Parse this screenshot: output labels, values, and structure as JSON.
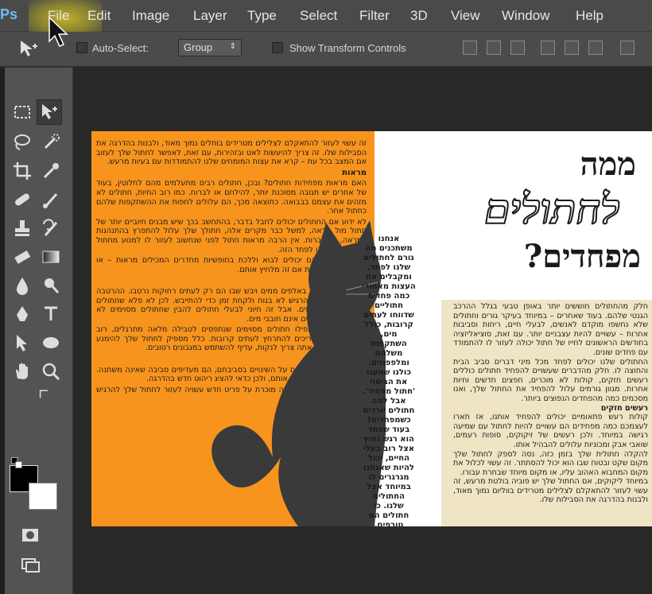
{
  "app": {
    "logo": "Ps",
    "menu": [
      "File",
      "Edit",
      "Image",
      "Layer",
      "Type",
      "Select",
      "Filter",
      "3D",
      "View",
      "Window",
      "Help"
    ]
  },
  "options": {
    "auto_select_label": "Auto-Select:",
    "group_value": "Group",
    "show_transform_label": "Show Transform Controls"
  },
  "colors": {
    "accent_orange": "#f7941d",
    "beige": "#efe4c4",
    "foreground": "#000000",
    "background": "#ffffff"
  },
  "doc": {
    "title_line1": "ממה",
    "title_line2": "לחתולים",
    "title_line3": "מפחדים?",
    "left_column": [
      {
        "type": "p",
        "text": "זה עשוי לעזור להתאקלם לצלילים מטרידים בוחלים נמוך מאוד, ולבנות בהדרגה את הסבילות שלו. זה צריך להיעשות לאט ובזהירות, עם זאת, לאפשר לחתול שלך לעזוב אם המצב בכל עת – קרא את עצות המומחים שלנו להתמודדות עם בעיות מרעש."
      },
      {
        "type": "h",
        "text": "מראות"
      },
      {
        "type": "p",
        "text": "האם מראות מפחידות חתולים? ובכן, חתולים רבים מתעלמים מהם לחלוטין, בעוד של אחרים יש תגובה מסוכנת יותר, להילחם או לברוח. כמו רוב החיות, חתולים לא מזהים את עצמם בבבואה. כתוצאה מכך, הם עלולים לחפות את ההשתקפות שלהם כחתול אחר."
      },
      {
        "type": "p",
        "text": "לא ידוע אם החתולים יכולים לחבל בדבר, בהתחשב בכך שיש מבנים חיוביים יותר של חתול מול מראה, למשל כבר מקרים אלה, חתולך שלך עלול להתפרץ בהתנהגות במראה, או לברוח. אין הרבה מראות חתול לפני שנחשוב לעזור לו למנוע מחתול להיות מפחיד או לפחד הזה."
      },
      {
        "type": "p",
        "text": "מלבד לוודא שהם יכולים לבוא וללכת בחופשיות מחדרים המכילים מראות – או להסיר את המראות אם זה מלחיץ אותם."
      },
      {
        "type": "h",
        "text": "מים"
      },
      {
        "type": "p",
        "text": "חתולים מתפחדים באלפים ממים ויבש שבו הם רק לעתים רחוקות נרטבו. ההרטבה גורמת לחתולים להרגיש לא בנוח ולקחת זמן כדי להתייבש. לכן לא פלא שחתולים רבים מפחדים ממים. אבל זה חיוני לבעלי חתולים להבין שחתולים מסוימים לא מחבבים מים ואחרים אינם חובבי מים."
      },
      {
        "type": "p",
        "text": "ושחייה. בעוד שאפילו חתולים מסוימים שנתפסים לטבילה מלאה מתרגלים, רוב החתולים אינם צריכים להתרחץ לעתים קרובות. כלל מספיק לחתול שלך להימנע ממים – אבל אם אתה צריך לנקות, עדיף להשתמש במגבונים רטובים."
      },
      {
        "type": "h",
        "text": "ריהוט חדש"
      },
      {
        "type": "p",
        "text": "כאשר חתולים מתרגלים על השינויים בסביבתם, הם מעדיפים סביבה שאינה משתנה. שינוי ריהוט יכול להפחיד אותם, ולכן כדאי להציג ריהוט חדש בהדרגה."
      },
      {
        "type": "p",
        "text": "אבל הנחת בריח או שמיכה מוכרת על פריט חדש עשויה לעזור לחתול שלך להרגיש בנוח יותר מהר ביותר."
      }
    ],
    "middle_column": "אנחנו משתכנים מה גורם לחתולים שלנו לפחד, ומקבלים את העצות מאחורי כמה פחדים חתוליים שדווחו לעתים קרובות, כולל מים, השתקפות משלהם ומלפפונים. כולנו שמענו את הביטוי 'חתול מפחיד'. אבל למה חתולים יורדים כשמפחדים? בעוד שפחד הוא רגש נפוץ אצל רוב בעלי החיים, יכול להיות שאנחנו מגרגרים לו במיוחד אצל החתולים שלנו. כי חתולים הם טורפים, השמירה, הראייה והריח הכחושה שלהם עוזרים להם להבחין כל כך מהר בדברים שאינם כשורה.",
    "right_column": [
      {
        "type": "p",
        "text": "חלק מהחתולים חוששים יותר באופן טבעי בגלל ההרכב הגנטי שלהם. בעוד שאחרים – במיוחד בעיקר גורים וחתולים שלא נחשפו מוקדם לאנשים, לבעלי חיים, ריחות וסביבות אחרות – עשויים להיות עצבניים יותר. עם זאת, סוציאליזציה בחודשים הראשונים לחייו של חתול יכולה לעזור לו להתמודד עם פחדים שונים."
      },
      {
        "type": "p",
        "text": "החתולים שלנו יכולים לפחד מכל מיני דברים סביב הבית והחוצה לו. חלק מהדברים שעשויים להפחיד חתולים כוללים רעשים חזקים, קולות לא מוכרים, חפצים חדשים וחיות אחרות. מגוון גורמים עלול להפחיד את החתול שלך, ואנו מסכמים כמה מהפחדים הנפוצים ביותר."
      },
      {
        "type": "h",
        "text": "רעשים חזקים"
      },
      {
        "type": "p",
        "text": "קולות רעש פתאומיים יכולים להפחיד אותנו, אז תארו לעצמכם כמה מפחידים הם עשויים להיות לחתול עם שמיעה רגישה במיוחד. ולכן רעשים של זיקוקים, סופות רעמים, שואבי אבק ומכוניות עלולים להבהיל אותו."
      },
      {
        "type": "p",
        "text": "להקלה חתולית שלך בזמן כזה, נסה לספק לחתול שלך מקום שקט ובטוח שבו הוא יכול להסתתר. זה עשוי לכלול את מקום המחבוא האהוב עליו, או מקום מיוחד שבחרת עבורו."
      },
      {
        "type": "p",
        "text": "במיוחד ליקוקים, אם החתול שלך יש פוביה בולטת מרעש, זה עשוי לעזור להתאקלם לצלילים מטרידים בווליום נמוך מאוד, ולבנות בהדרגה את הסבילות שלו."
      }
    ]
  }
}
